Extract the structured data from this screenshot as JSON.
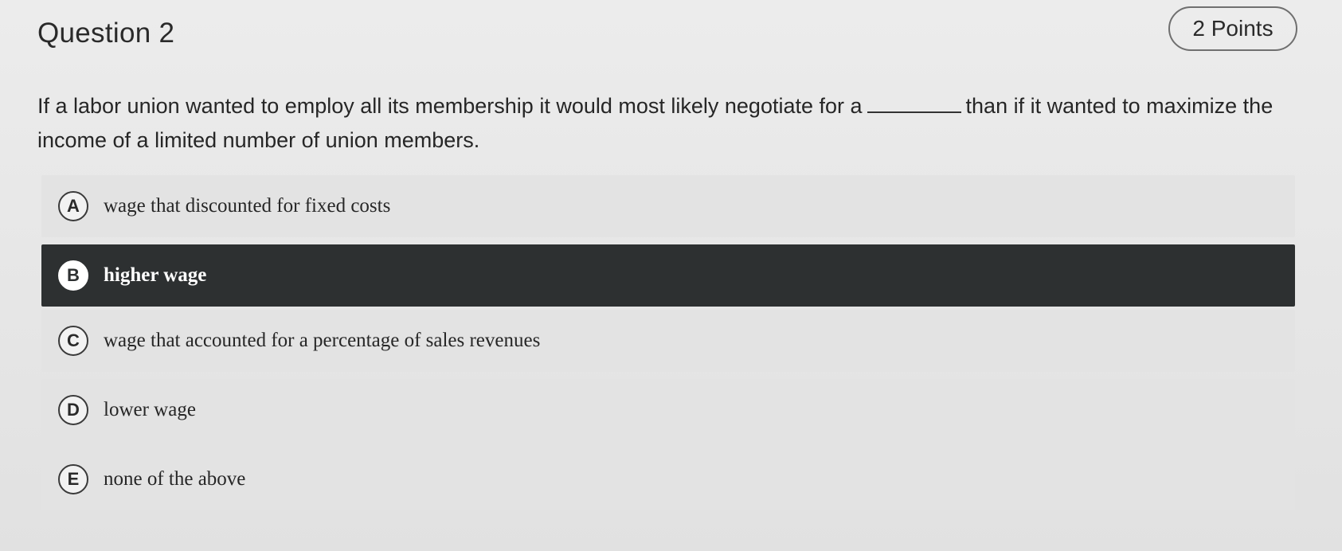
{
  "question": {
    "title": "Question 2",
    "points": "2 Points",
    "prompt_before": "If a labor union wanted to employ all its membership it would most likely negotiate for a",
    "prompt_after": "than if it wanted to maximize the income of a limited number of union members."
  },
  "choices": [
    {
      "letter": "A",
      "text": "wage that discounted for fixed costs",
      "selected": false
    },
    {
      "letter": "B",
      "text": "higher wage",
      "selected": true
    },
    {
      "letter": "C",
      "text": "wage that accounted for a percentage of sales revenues",
      "selected": false
    },
    {
      "letter": "D",
      "text": "lower wage",
      "selected": false
    },
    {
      "letter": "E",
      "text": "none of the above",
      "selected": false
    }
  ],
  "colors": {
    "background": "#e6e6e6",
    "selected_background": "#2d3031",
    "selected_text": "#ffffff",
    "text": "#262626"
  }
}
